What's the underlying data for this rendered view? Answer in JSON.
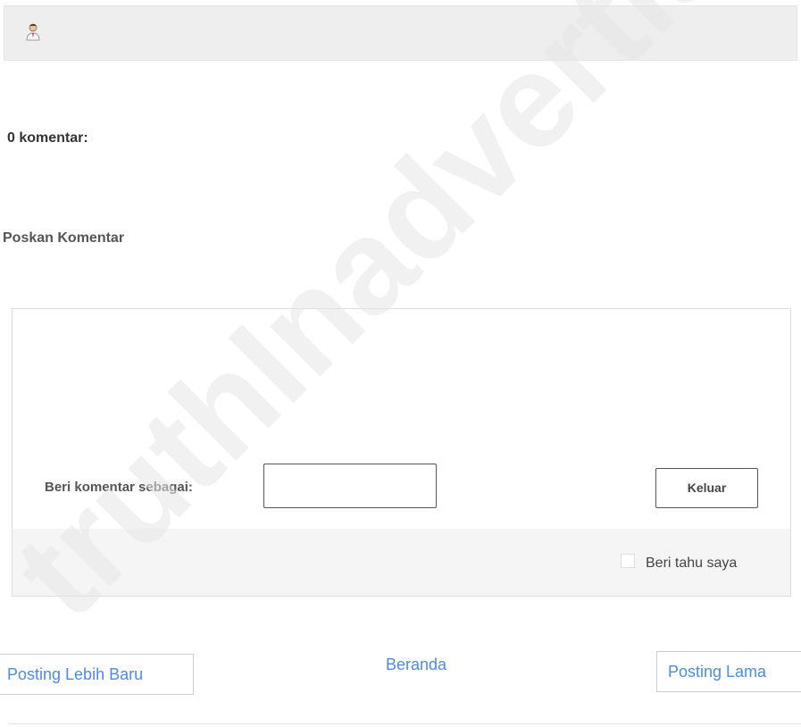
{
  "comments": {
    "count_label": "0 komentar:",
    "post_title": "Poskan Komentar"
  },
  "form": {
    "comment_as_label": "Beri komentar sebagai:",
    "signout_label": "Keluar",
    "notify_label": "Beri tahu saya",
    "identity_value": ""
  },
  "nav": {
    "newer": "Posting Lebih Baru",
    "home": "Beranda",
    "older": "Posting Lama"
  },
  "watermark": {
    "text": "truthInadvertisl",
    "color": "#e6e6e6"
  },
  "colors": {
    "link": "#4d8ce0"
  }
}
